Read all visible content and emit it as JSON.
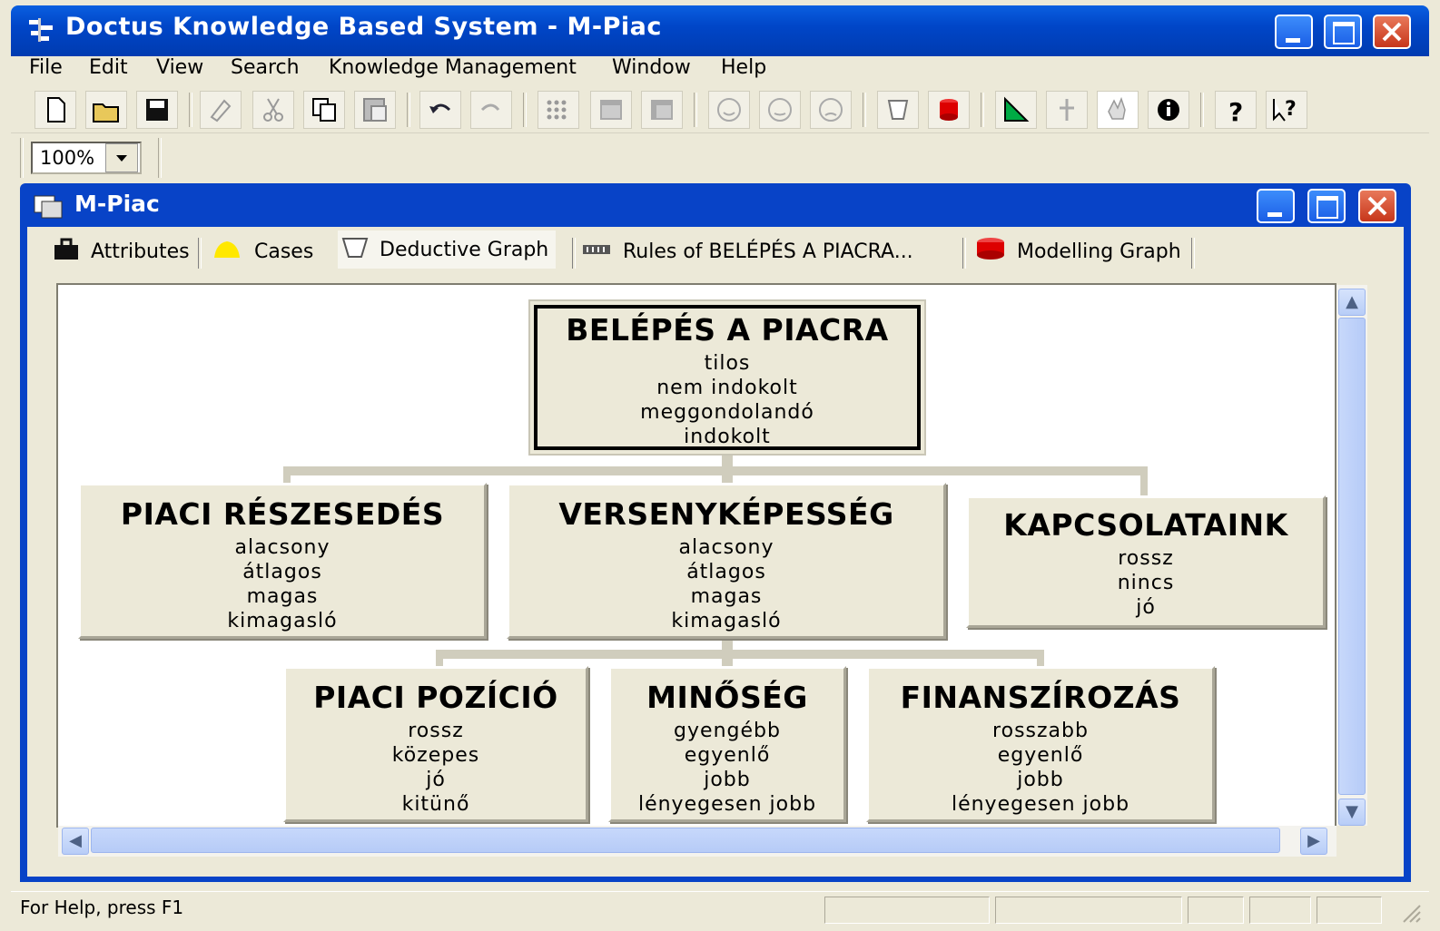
{
  "app": {
    "title": "Doctus Knowledge Based System - M-Piac"
  },
  "menu": [
    "File",
    "Edit",
    "View",
    "Search",
    "Knowledge Management",
    "Window",
    "Help"
  ],
  "toolbar": {
    "buttons": [
      "new-file-icon",
      "open-folder-icon",
      "save-icon",
      "eraser-icon",
      "cut-icon",
      "copy-icon",
      "paste-icon",
      "undo-icon",
      "redo-icon",
      "grid-dots-icon",
      "grid-table-icon",
      "grid-table2-icon",
      "smiley-icon",
      "smiley-neutral-icon",
      "smiley-sad-icon",
      "deductive-graph-icon",
      "modelling-graph-icon",
      "triangle-icon",
      "pin-icon",
      "hand-icon",
      "info-icon",
      "help-icon",
      "context-help-icon"
    ],
    "zoom_value": "100%"
  },
  "child_window": {
    "title": "M-Piac"
  },
  "tabs": [
    {
      "label": "Attributes",
      "icon": "bag-icon"
    },
    {
      "label": "Cases",
      "icon": "bell-icon"
    },
    {
      "label": "Deductive Graph",
      "icon": "cup-icon",
      "active": true
    },
    {
      "label": "Rules of BELÉPÉS A PIACRA...",
      "icon": "bar-chart-icon"
    },
    {
      "label": "Modelling Graph",
      "icon": "cylinder-icon"
    }
  ],
  "graph": {
    "root": {
      "title": "BELÉPÉS A PIACRA",
      "values": [
        "tilos",
        "nem indokolt",
        "meggondolandó",
        "indokolt"
      ]
    },
    "level1": [
      {
        "title": "PIACI RÉSZESEDÉS",
        "values": [
          "alacsony",
          "átlagos",
          "magas",
          "kimagasló"
        ]
      },
      {
        "title": "VERSENYKÉPESSÉG",
        "values": [
          "alacsony",
          "átlagos",
          "magas",
          "kimagasló"
        ]
      },
      {
        "title": "KAPCSOLATAINK",
        "values": [
          "rossz",
          "nincs",
          "jó"
        ]
      }
    ],
    "level2": [
      {
        "title": "PIACI POZÍCIÓ",
        "values": [
          "rossz",
          "közepes",
          "jó",
          "kitünő"
        ]
      },
      {
        "title": "MINŐSÉG",
        "values": [
          "gyengébb",
          "egyenlő",
          "jobb",
          "lényegesen jobb"
        ]
      },
      {
        "title": "FINANSZÍROZÁS",
        "values": [
          "rosszabb",
          "egyenlő",
          "jobb",
          "lényegesen jobb"
        ]
      }
    ]
  },
  "status": {
    "text": "For Help, press F1"
  },
  "colors": {
    "titlebar": "#0046c8",
    "face": "#ece9d8",
    "canvas": "#ffffff"
  }
}
